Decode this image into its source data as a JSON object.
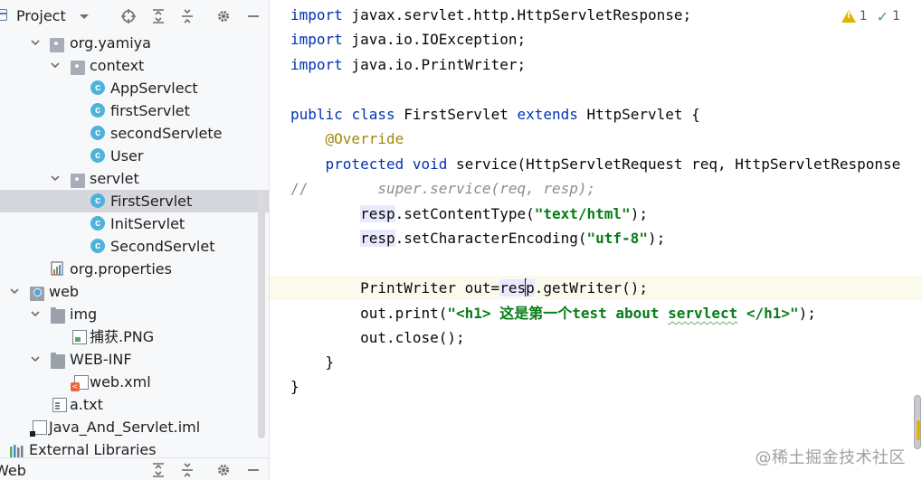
{
  "project_panel": {
    "title": "Project",
    "tree": [
      {
        "label": "org.yamiya"
      },
      {
        "label": "context"
      },
      {
        "label": "AppServlect"
      },
      {
        "label": "firstServlet"
      },
      {
        "label": "secondServlete"
      },
      {
        "label": "User"
      },
      {
        "label": "servlet"
      },
      {
        "label": "FirstServlet"
      },
      {
        "label": "InitServlet"
      },
      {
        "label": "SecondServlet"
      },
      {
        "label": "org.properties"
      },
      {
        "label": "web"
      },
      {
        "label": "img"
      },
      {
        "label": "捕获.PNG"
      },
      {
        "label": "WEB-INF"
      },
      {
        "label": "web.xml"
      },
      {
        "label": "a.txt"
      },
      {
        "label": "Java_And_Servlet.iml"
      },
      {
        "label": "External Libraries"
      }
    ],
    "class_icon_letter": "c",
    "bottom_title": "Web"
  },
  "editor": {
    "inspection": {
      "warnings": "1",
      "typos": "1"
    },
    "lines": {
      "l1": [
        "import",
        " javax.servlet.http.HttpServletResponse;"
      ],
      "l2": [
        "import",
        " java.io.IOException;"
      ],
      "l3": [
        "import",
        " java.io.PrintWriter;"
      ],
      "l5": [
        "public",
        " ",
        "class",
        " FirstServlet ",
        "extends",
        " HttpServlet {"
      ],
      "l6": [
        "    ",
        "@Override"
      ],
      "l7": [
        "    ",
        "protected",
        " ",
        "void",
        " service(HttpServletRequest req, HttpServletResponse"
      ],
      "l8": [
        "//",
        "        super.service(req, resp);"
      ],
      "l9": [
        "        ",
        "resp",
        ".setContentType(",
        "\"text/html\"",
        ");"
      ],
      "l10": [
        "        ",
        "resp",
        ".setCharacterEncoding(",
        "\"utf-8\"",
        ");"
      ],
      "l12": [
        "        PrintWriter out=",
        "res",
        "p",
        ".getWriter();"
      ],
      "l13": [
        "        out.print(",
        "\"<h1> 这是第一个test about ",
        "servlect",
        " </h1>\"",
        ");"
      ],
      "l14": [
        "        out.close();"
      ],
      "l15": [
        "    }"
      ],
      "l16": [
        "}"
      ]
    }
  },
  "watermark": "@稀土掘金技术社区",
  "colors": {
    "keyword": "#0033b3",
    "string": "#067d17",
    "annotation": "#9e880d",
    "comment": "#8c8c8c",
    "selection": "#d5d7dd",
    "current_line": "#fcfaed"
  }
}
